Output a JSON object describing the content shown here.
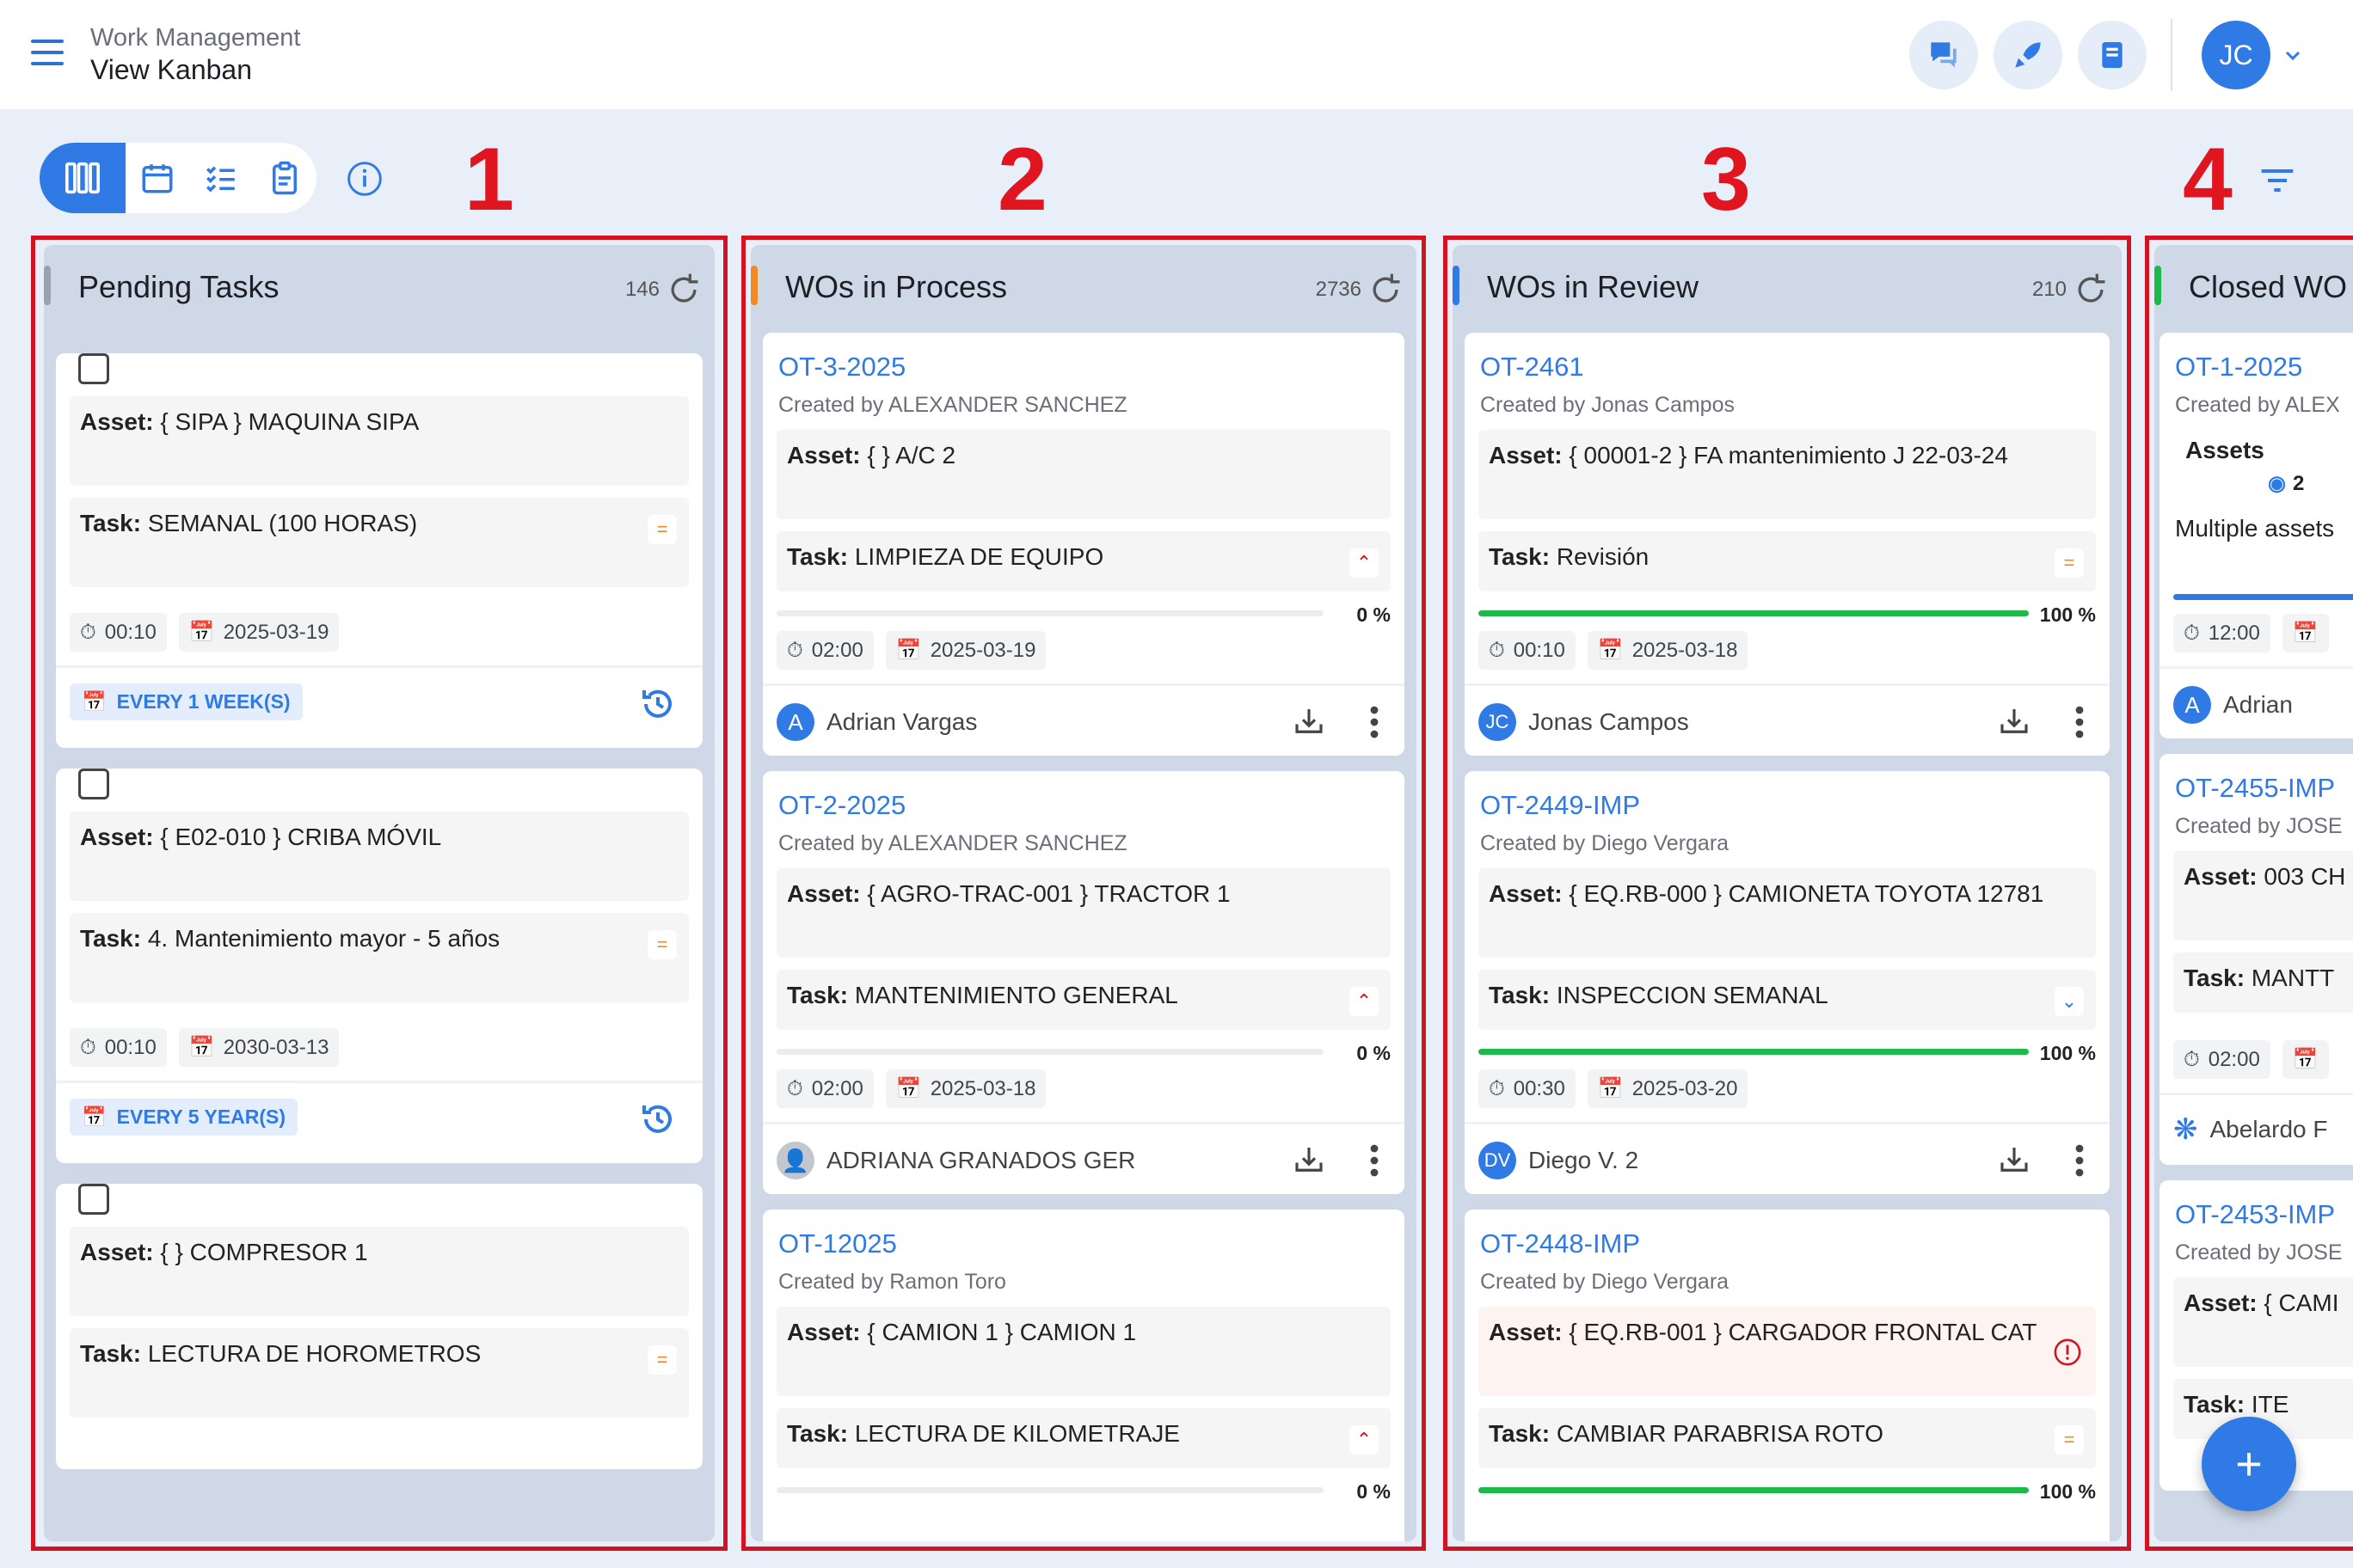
{
  "header": {
    "subtitle": "Work Management",
    "title": "View Kanban",
    "user_initials": "JC",
    "icons": [
      "chat-icon",
      "rocket-icon",
      "book-icon"
    ]
  },
  "toolbar": {
    "views": [
      "kanban-view-icon",
      "calendar-view-icon",
      "checklist-view-icon",
      "clipboard-view-icon"
    ],
    "active_view": "kanban-view-icon"
  },
  "column_numbers": [
    "1",
    "2",
    "3",
    "4"
  ],
  "columns": [
    {
      "title": "Pending Tasks",
      "count": "146",
      "color": "#9aa3ad",
      "cards": [
        {
          "asset": "{ SIPA } MAQUINA SIPA",
          "task": "SEMANAL (100 HORAS)",
          "time": "00:10",
          "date": "2025-03-19",
          "repeat": "EVERY 1 WEEK(S)"
        },
        {
          "asset": "{ E02-010 } CRIBA MÓVIL",
          "task": "4. Mantenimiento mayor - 5 años",
          "time": "00:10",
          "date": "2030-03-13",
          "repeat": "EVERY 5 YEAR(S)"
        },
        {
          "asset": "{  } COMPRESOR 1",
          "task": "LECTURA DE HOROMETROS"
        }
      ]
    },
    {
      "title": "WOs in Process",
      "count": "2736",
      "color": "#f08a24",
      "cards": [
        {
          "code": "OT-3-2025",
          "created": "Created by ALEXANDER SANCHEZ",
          "asset": "{  } A/C 2",
          "task": "LIMPIEZA DE EQUIPO",
          "progress": "0 %",
          "time": "02:00",
          "date": "2025-03-19",
          "assignee": "Adrian Vargas",
          "avatar": "A"
        },
        {
          "code": "OT-2-2025",
          "created": "Created by ALEXANDER SANCHEZ",
          "asset": "{ AGRO-TRAC-001 } TRACTOR 1",
          "task": "MANTENIMIENTO GENERAL",
          "progress": "0 %",
          "time": "02:00",
          "date": "2025-03-18",
          "assignee": "ADRIANA GRANADOS GER",
          "avatar": ""
        },
        {
          "code": "OT-12025",
          "created": "Created by Ramon Toro",
          "asset": "{ CAMION 1 } CAMION 1",
          "task": "LECTURA DE KILOMETRAJE",
          "progress": "0 %"
        }
      ]
    },
    {
      "title": "WOs in Review",
      "count": "210",
      "color": "#2f7ae5",
      "cards": [
        {
          "code": "OT-2461",
          "created": "Created by Jonas Campos",
          "asset": "{ 00001-2 } FA mantenimiento J  22-03-24",
          "task": "Revisión",
          "progress": "100 %",
          "time": "00:10",
          "date": "2025-03-18",
          "assignee": "Jonas Campos",
          "avatar": "JC"
        },
        {
          "code": "OT-2449-IMP",
          "created": "Created by Diego Vergara",
          "asset": "{ EQ.RB-000 } CAMIONETA TOYOTA 12781",
          "task": "INSPECCION SEMANAL",
          "progress": "100 %",
          "time": "00:30",
          "date": "2025-03-20",
          "assignee": "Diego V. 2",
          "avatar": "DV"
        },
        {
          "code": "OT-2448-IMP",
          "created": "Created by Diego Vergara",
          "asset": "{ EQ.RB-001 } CARGADOR FRONTAL CAT",
          "task": "CAMBIAR PARABRISA ROTO",
          "progress": "100 %"
        }
      ]
    },
    {
      "title": "Closed WO",
      "color": "#1fb84a",
      "cards": [
        {
          "code": "OT-1-2025",
          "created": "Created by ALEX",
          "assets_label": "Assets",
          "assets_count": "2",
          "multiple": "Multiple assets",
          "time": "12:00",
          "assignee": "Adrian",
          "avatar": "A"
        },
        {
          "code": "OT-2455-IMP",
          "created": "Created by JOSE",
          "asset": "003 CH",
          "task": "MANTT",
          "time": "02:00",
          "assignee": "Abelardo F"
        },
        {
          "code": "OT-2453-IMP",
          "created": "Created by JOSE",
          "asset": "{ CAMI",
          "task": "ITE"
        }
      ]
    }
  ],
  "labels": {
    "asset": "Asset:",
    "task": "Task:"
  },
  "fab": "+"
}
